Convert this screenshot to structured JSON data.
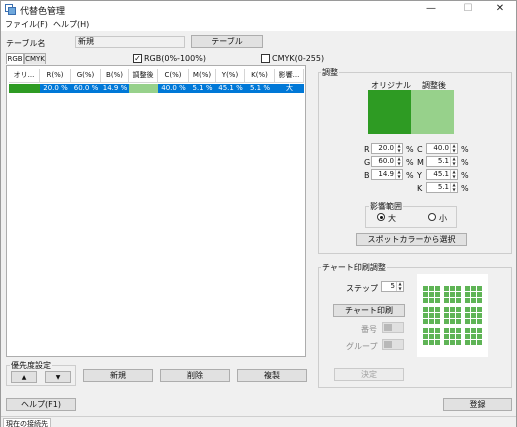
{
  "window": {
    "title": "代替色管理",
    "minimize": "—",
    "maximize": "☐",
    "close": "✕"
  },
  "menu": {
    "file": "ファイル(F)",
    "help": "ヘルプ(H)"
  },
  "table_row": {
    "label": "テーブル名",
    "value": "新規",
    "button": "テーブル"
  },
  "filters": {
    "rgb_label": "RGB(0%-100%)",
    "rgb_checked": true,
    "cmyk_label": "CMYK(0-255)",
    "cmyk_checked": false
  },
  "tabs": [
    {
      "label": "RGB",
      "selected": true
    },
    {
      "label": "CMYK",
      "selected": false
    }
  ],
  "grid": {
    "columns": [
      "オリ...",
      "R(%)",
      "G(%)",
      "B(%)",
      "調整後",
      "C(%)",
      "M(%)",
      "Y(%)",
      "K(%)",
      "影響..."
    ],
    "rows": [
      {
        "original_color": "#2e9b23",
        "r": "20.0 %",
        "g": "60.0 %",
        "b": "14.9 %",
        "adjusted_color": "#97d18b",
        "c": "40.0 %",
        "m": "5.1 %",
        "y": "45.1 %",
        "k": "5.1 %",
        "influence": "大"
      }
    ]
  },
  "priority": {
    "label": "優先度設定",
    "up": "▲",
    "down": "▼"
  },
  "actions": {
    "new": "新規",
    "delete": "削除",
    "copy": "複製"
  },
  "adjust": {
    "label": "調整",
    "original_label": "オリジナル",
    "adjusted_label": "調整後",
    "original_color": "#2e9b23",
    "adjusted_color": "#97d18b",
    "fields": {
      "r": {
        "label": "R",
        "value": "20.0"
      },
      "g": {
        "label": "G",
        "value": "60.0"
      },
      "b": {
        "label": "B",
        "value": "14.9"
      },
      "c": {
        "label": "C",
        "value": "40.0"
      },
      "m": {
        "label": "M",
        "value": "5.1"
      },
      "y": {
        "label": "Y",
        "value": "45.1"
      },
      "k": {
        "label": "K",
        "value": "5.1"
      }
    },
    "unit": "%",
    "influence": {
      "label": "影響範囲",
      "large": "大",
      "small": "小",
      "selected": "large"
    },
    "spot_button": "スポットカラーから選択"
  },
  "chart": {
    "label": "チャート印刷調整",
    "step_label": "ステップ",
    "step_value": "5",
    "print_button": "チャート印刷",
    "number_label": "番号",
    "group_label": "グループ",
    "decide_button": "決定",
    "swatch_color": "#5fb456"
  },
  "footer": {
    "help": "ヘルプ(F1)",
    "register": "登録"
  },
  "status": {
    "connection": "現在の接続先"
  }
}
